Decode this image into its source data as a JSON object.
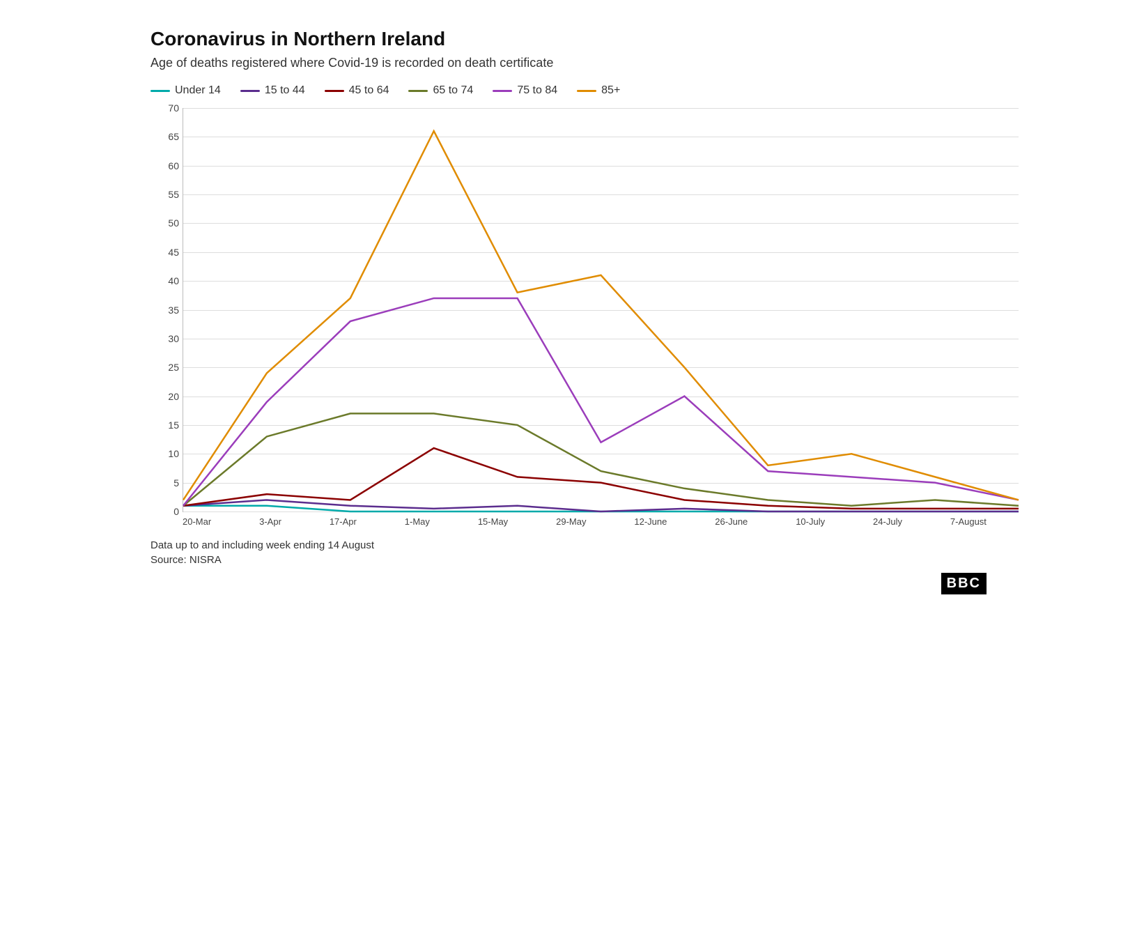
{
  "title": "Coronavirus in Northern Ireland",
  "subtitle": "Age of deaths registered where Covid-19 is recorded on death certificate",
  "legend": [
    {
      "label": "Under 14",
      "color": "#00AAAA",
      "id": "under14"
    },
    {
      "label": "15 to 44",
      "color": "#5B2D8E",
      "id": "15to44"
    },
    {
      "label": "45 to 64",
      "color": "#8B0000",
      "id": "45to64"
    },
    {
      "label": "65 to 74",
      "color": "#6B7A2A",
      "id": "65to74"
    },
    {
      "label": "75 to 84",
      "color": "#9B3DBB",
      "id": "75to84"
    },
    {
      "label": "85+",
      "color": "#E08C00",
      "id": "85plus"
    }
  ],
  "yAxis": {
    "max": 70,
    "labels": [
      70,
      65,
      60,
      55,
      50,
      45,
      40,
      35,
      30,
      25,
      20,
      15,
      10,
      5,
      0
    ]
  },
  "xAxis": {
    "labels": [
      "20-Mar",
      "3-Apr",
      "17-Apr",
      "1-May",
      "15-May",
      "29-May",
      "12-June",
      "26-June",
      "10-July",
      "24-July",
      "7-August"
    ]
  },
  "footer": {
    "note": "Data up to and including week ending 14 August",
    "source": "Source: NISRA"
  },
  "bbc": "BBC",
  "series": {
    "under14": [
      1,
      1,
      0,
      0,
      0,
      0,
      0,
      0,
      0,
      0,
      0
    ],
    "15to44": [
      1,
      2,
      1,
      0.5,
      1,
      0,
      0.5,
      0,
      0,
      0,
      0
    ],
    "45to64": [
      1,
      3,
      2,
      11,
      6,
      5,
      2,
      1,
      0.5,
      0.5,
      0.5
    ],
    "65to74": [
      1,
      13,
      17,
      17,
      15,
      7,
      4,
      2,
      1,
      2,
      1
    ],
    "75to84": [
      1,
      19,
      33,
      37,
      37,
      12,
      20,
      7,
      6,
      5,
      2
    ],
    "85plus": [
      2,
      24,
      37,
      66,
      38,
      41,
      25,
      8,
      10,
      6,
      2
    ]
  }
}
